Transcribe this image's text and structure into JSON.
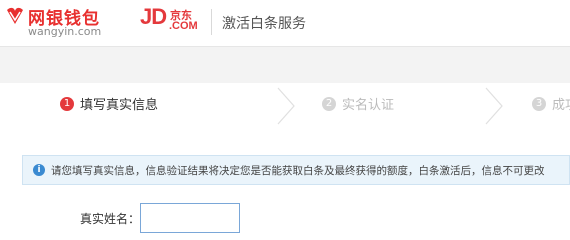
{
  "header": {
    "wangyin_logo_cn": "网银钱包",
    "wangyin_logo_en": "wangyin.com",
    "jd_logo_mark": "JD",
    "jd_logo_cn": "京东",
    "jd_logo_com": ".COM",
    "service_title": "激活白条服务"
  },
  "steps": [
    {
      "number": "1",
      "label": "填写真实信息",
      "state": "active"
    },
    {
      "number": "2",
      "label": "实名认证",
      "state": "inactive"
    },
    {
      "number": "3",
      "label": "成功",
      "state": "inactive"
    }
  ],
  "info": {
    "icon": "info-icon",
    "message": "请您填写真实信息，信息验证结果将决定您是否能获取白条及最终获得的额度，白条激活后，信息不可更改"
  },
  "form": {
    "name_label": "真实姓名：",
    "name_value": "",
    "name_placeholder": ""
  },
  "colors": {
    "brand_red": "#e4393c",
    "info_blue": "#3a8ad1",
    "info_bg": "#eaf4fb",
    "band_gray": "#f3f3f3"
  }
}
